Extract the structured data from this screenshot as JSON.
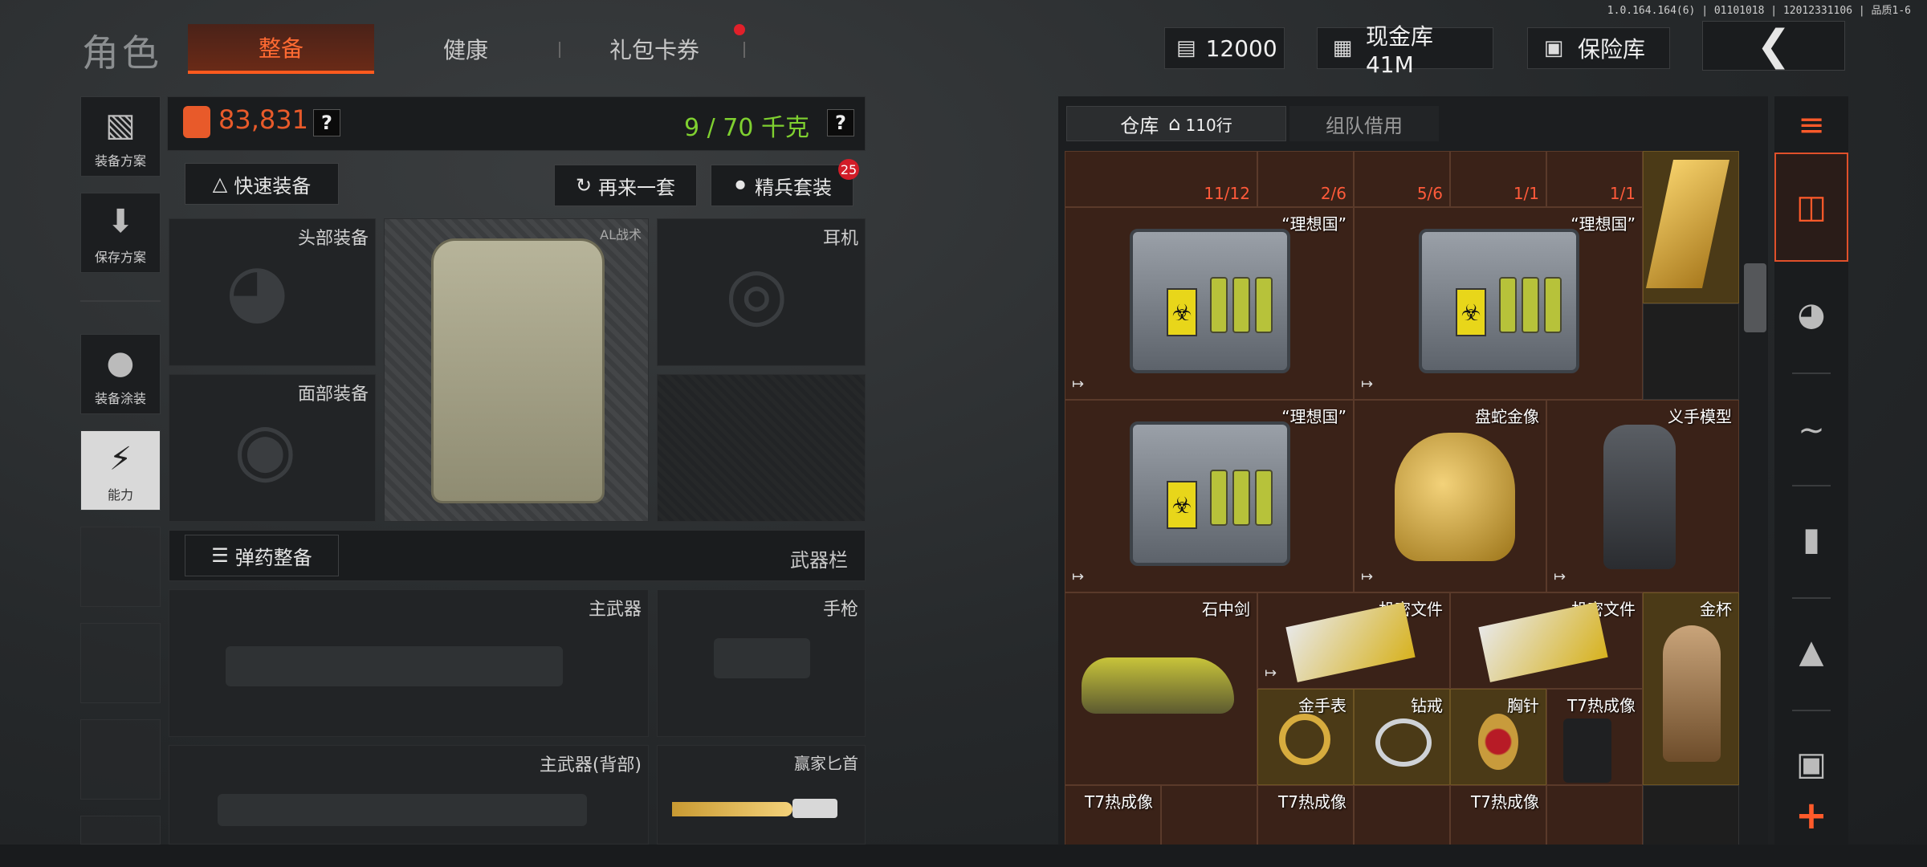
{
  "version": "1.0.164.164(6) | 01101018 | 12012331106 | 品质1-6",
  "header": {
    "title": "角色",
    "tabs": [
      {
        "label": "整备",
        "active": true
      },
      {
        "label": "健康",
        "active": false
      },
      {
        "label": "礼包卡券",
        "active": false,
        "notification": true
      }
    ],
    "currency": {
      "amount": "12000",
      "icon": "cash-icon"
    },
    "cash_vault": {
      "label": "现金库 41M",
      "icon": "vault-icon"
    },
    "safe": {
      "label": "保险库",
      "icon": "safe-icon"
    },
    "back_icon": "chevron-left-icon"
  },
  "sidebar": [
    {
      "label": "装备方案",
      "icon": "vest-icon"
    },
    {
      "label": "保存方案",
      "icon": "download-icon"
    },
    {
      "label": "装备涂装",
      "icon": "helmet-paint-icon"
    },
    {
      "label": "能力",
      "icon": "ability-icon",
      "highlight": true
    }
  ],
  "loadout": {
    "value": "83,831",
    "help": "?",
    "capacity": "9 / 70 千克",
    "quick_equip": "快速装备",
    "reroll": "再来一套",
    "elite_set": "精兵套装",
    "elite_badge": "25",
    "slots": {
      "head": "头部装备",
      "face": "面部装备",
      "armor_brand": "AL战术",
      "headset": "耳机"
    },
    "ammo_equip": "弹药整备",
    "weapon_bar": "武器栏",
    "primary": "主武器",
    "pistol": "手枪",
    "primary_back": "主武器(背部)",
    "knife": "赢家匕首"
  },
  "warehouse": {
    "tab_storage": "仓库",
    "storage_rows": "110行",
    "tab_team": "组队借用",
    "top_counts": [
      "11/12",
      "2/6",
      "5/6",
      "1/1",
      "1/1"
    ],
    "items": [
      {
        "label": "“理想国”"
      },
      {
        "label": "“理想国”"
      },
      {
        "label": "“理想国”"
      },
      {
        "label": "盘蛇金像"
      },
      {
        "label": "义手模型"
      },
      {
        "label": "石中剑"
      },
      {
        "label": "机密文件"
      },
      {
        "label": "机密文件"
      },
      {
        "label": "金杯"
      },
      {
        "label": "金手表"
      },
      {
        "label": "钻戒"
      },
      {
        "label": "胸针"
      },
      {
        "label": "T7热成像"
      },
      {
        "label": "T7热成像"
      },
      {
        "label": "T7热成像"
      },
      {
        "label": "T7热成像"
      }
    ]
  },
  "rightbar": [
    "stack-refresh-icon",
    "layers-icon",
    "helmet-icon",
    "rifle-icon",
    "magazine-icon",
    "bullet-icon",
    "sight-icon",
    "add-icon"
  ]
}
